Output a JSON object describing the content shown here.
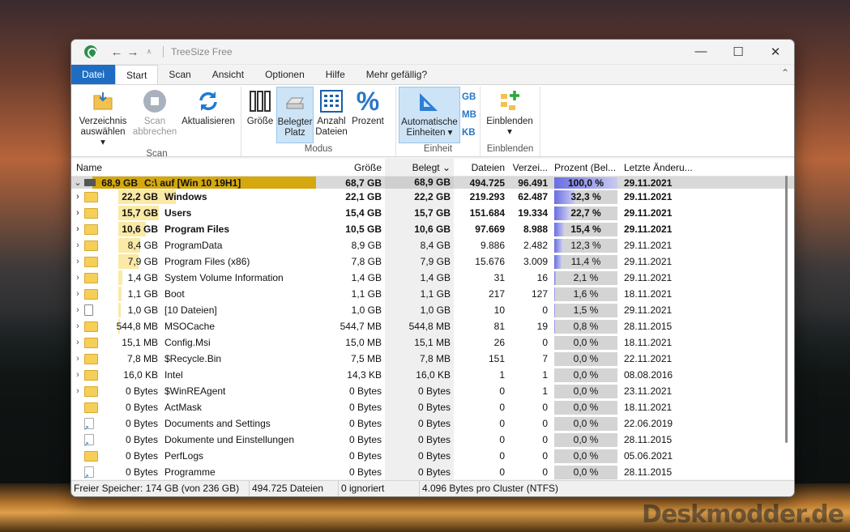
{
  "window": {
    "title": "TreeSize Free",
    "controls": {
      "minimize": "—",
      "maximize": "☐",
      "close": "✕"
    }
  },
  "tabs": [
    "Datei",
    "Start",
    "Scan",
    "Ansicht",
    "Optionen",
    "Hilfe",
    "Mehr gefällig?"
  ],
  "ribbon": {
    "scan_group": {
      "label": "Scan",
      "choose_dir": "Verzeichnis auswählen ▾",
      "choose_dir_l1": "Verzeichnis",
      "choose_dir_l2": "auswählen ▾",
      "abort_l1": "Scan",
      "abort_l2": "abbrechen",
      "refresh": "Aktualisieren"
    },
    "mode_group": {
      "label": "Modus",
      "size": "Größe",
      "used_l1": "Belegter",
      "used_l2": "Platz",
      "count_l1": "Anzahl",
      "count_l2": "Dateien",
      "percent": "Prozent"
    },
    "unit_group": {
      "label": "Einheit",
      "auto_l1": "Automatische",
      "auto_l2": "Einheiten ▾",
      "units": [
        "GB",
        "MB",
        "KB"
      ]
    },
    "show_group": {
      "label": "Einblenden",
      "show_l1": "Einblenden",
      "show_l2": "▾"
    }
  },
  "columns": {
    "name": "Name",
    "size": "Größe",
    "used": "Belegt ⌄",
    "files": "Dateien",
    "dirs": "Verzei...",
    "pct": "Prozent (Bel...",
    "date": "Letzte Änderu..."
  },
  "root_row": {
    "size_label": "68,9 GB",
    "name": "C:\\ auf  [Win 10 19H1]",
    "size": "68,7 GB",
    "used": "68,9 GB",
    "files": "494.725",
    "dirs": "96.491",
    "pct": "100,0 %",
    "pct_value": 100.0,
    "date": "29.11.2021"
  },
  "rows": [
    {
      "bar_size": "22,2 GB",
      "name": "Windows",
      "size": "22,1 GB",
      "used": "22,2 GB",
      "files": "219.293",
      "dirs": "62.487",
      "pct": "32,3 %",
      "pct_value": 32.3,
      "date": "29.11.2021",
      "bold": true,
      "expandable": true,
      "icon": "folder"
    },
    {
      "bar_size": "15,7 GB",
      "name": "Users",
      "size": "15,4 GB",
      "used": "15,7 GB",
      "files": "151.684",
      "dirs": "19.334",
      "pct": "22,7 %",
      "pct_value": 22.7,
      "date": "29.11.2021",
      "bold": true,
      "expandable": true,
      "icon": "folder"
    },
    {
      "bar_size": "10,6 GB",
      "name": "Program Files",
      "size": "10,5 GB",
      "used": "10,6 GB",
      "files": "97.669",
      "dirs": "8.988",
      "pct": "15,4 %",
      "pct_value": 15.4,
      "date": "29.11.2021",
      "bold": true,
      "expandable": true,
      "icon": "folder"
    },
    {
      "bar_size": "8,4 GB",
      "name": "ProgramData",
      "size": "8,9 GB",
      "used": "8,4 GB",
      "files": "9.886",
      "dirs": "2.482",
      "pct": "12,3 %",
      "pct_value": 12.3,
      "date": "29.11.2021",
      "bold": false,
      "expandable": true,
      "icon": "folder"
    },
    {
      "bar_size": "7,9 GB",
      "name": "Program Files (x86)",
      "size": "7,8 GB",
      "used": "7,9 GB",
      "files": "15.676",
      "dirs": "3.009",
      "pct": "11,4 %",
      "pct_value": 11.4,
      "date": "29.11.2021",
      "bold": false,
      "expandable": true,
      "icon": "folder"
    },
    {
      "bar_size": "1,4 GB",
      "name": "System Volume Information",
      "size": "1,4 GB",
      "used": "1,4 GB",
      "files": "31",
      "dirs": "16",
      "pct": "2,1 %",
      "pct_value": 2.1,
      "date": "29.11.2021",
      "bold": false,
      "expandable": true,
      "icon": "folder"
    },
    {
      "bar_size": "1,1 GB",
      "name": "Boot",
      "size": "1,1 GB",
      "used": "1,1 GB",
      "files": "217",
      "dirs": "127",
      "pct": "1,6 %",
      "pct_value": 1.6,
      "date": "18.11.2021",
      "bold": false,
      "expandable": true,
      "icon": "folder"
    },
    {
      "bar_size": "1,0 GB",
      "name": "[10 Dateien]",
      "size": "1,0 GB",
      "used": "1,0 GB",
      "files": "10",
      "dirs": "0",
      "pct": "1,5 %",
      "pct_value": 1.5,
      "date": "29.11.2021",
      "bold": false,
      "expandable": true,
      "icon": "file"
    },
    {
      "bar_size": "544,8 MB",
      "name": "MSOCache",
      "size": "544,7 MB",
      "used": "544,8 MB",
      "files": "81",
      "dirs": "19",
      "pct": "0,8 %",
      "pct_value": 0.8,
      "date": "28.11.2015",
      "bold": false,
      "expandable": true,
      "icon": "folder"
    },
    {
      "bar_size": "15,1 MB",
      "name": "Config.Msi",
      "size": "15,0 MB",
      "used": "15,1 MB",
      "files": "26",
      "dirs": "0",
      "pct": "0,0 %",
      "pct_value": 0.0,
      "date": "18.11.2021",
      "bold": false,
      "expandable": true,
      "icon": "folder"
    },
    {
      "bar_size": "7,8 MB",
      "name": "$Recycle.Bin",
      "size": "7,5 MB",
      "used": "7,8 MB",
      "files": "151",
      "dirs": "7",
      "pct": "0,0 %",
      "pct_value": 0.0,
      "date": "22.11.2021",
      "bold": false,
      "expandable": true,
      "icon": "folder"
    },
    {
      "bar_size": "16,0 KB",
      "name": "Intel",
      "size": "14,3 KB",
      "used": "16,0 KB",
      "files": "1",
      "dirs": "1",
      "pct": "0,0 %",
      "pct_value": 0.0,
      "date": "08.08.2016",
      "bold": false,
      "expandable": true,
      "icon": "folder"
    },
    {
      "bar_size": "0 Bytes",
      "name": "$WinREAgent",
      "size": "0 Bytes",
      "used": "0 Bytes",
      "files": "0",
      "dirs": "1",
      "pct": "0,0 %",
      "pct_value": 0.0,
      "date": "23.11.2021",
      "bold": false,
      "expandable": true,
      "icon": "folder"
    },
    {
      "bar_size": "0 Bytes",
      "name": "ActMask",
      "size": "0 Bytes",
      "used": "0 Bytes",
      "files": "0",
      "dirs": "0",
      "pct": "0,0 %",
      "pct_value": 0.0,
      "date": "18.11.2021",
      "bold": false,
      "expandable": false,
      "icon": "folder"
    },
    {
      "bar_size": "0 Bytes",
      "name": "Documents and Settings",
      "size": "0 Bytes",
      "used": "0 Bytes",
      "files": "0",
      "dirs": "0",
      "pct": "0,0 %",
      "pct_value": 0.0,
      "date": "22.06.2019",
      "bold": false,
      "expandable": false,
      "icon": "link"
    },
    {
      "bar_size": "0 Bytes",
      "name": "Dokumente und Einstellungen",
      "size": "0 Bytes",
      "used": "0 Bytes",
      "files": "0",
      "dirs": "0",
      "pct": "0,0 %",
      "pct_value": 0.0,
      "date": "28.11.2015",
      "bold": false,
      "expandable": false,
      "icon": "link"
    },
    {
      "bar_size": "0 Bytes",
      "name": "PerfLogs",
      "size": "0 Bytes",
      "used": "0 Bytes",
      "files": "0",
      "dirs": "0",
      "pct": "0,0 %",
      "pct_value": 0.0,
      "date": "05.06.2021",
      "bold": false,
      "expandable": false,
      "icon": "folder"
    },
    {
      "bar_size": "0 Bytes",
      "name": "Programme",
      "size": "0 Bytes",
      "used": "0 Bytes",
      "files": "0",
      "dirs": "0",
      "pct": "0,0 %",
      "pct_value": 0.0,
      "date": "28.11.2015",
      "bold": false,
      "expandable": false,
      "icon": "link"
    }
  ],
  "status": {
    "free": "Freier Speicher: 174 GB  (von 236 GB)",
    "files": "494.725 Dateien",
    "ignored": "0 ignoriert",
    "cluster": "4.096 Bytes pro Cluster (NTFS)"
  },
  "watermark": "Deskmodder.de"
}
